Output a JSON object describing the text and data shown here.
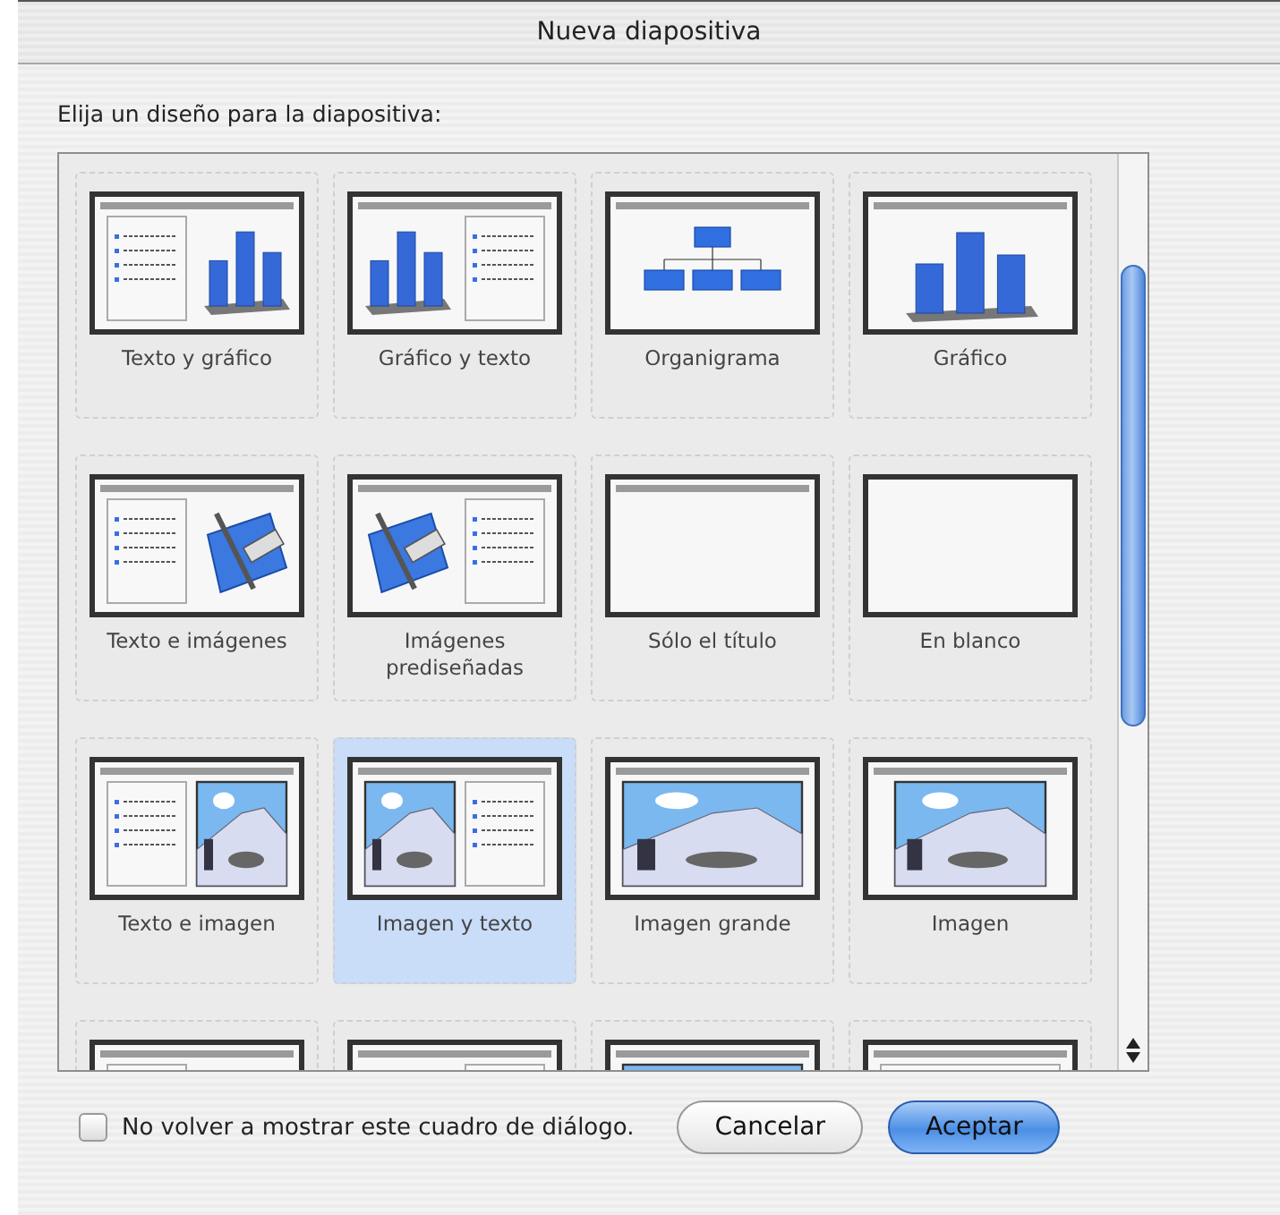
{
  "window": {
    "title": "Nueva diapositiva"
  },
  "prompt": "Elija un diseño para la diapositiva:",
  "layouts": [
    {
      "label": "Texto y gráfico",
      "kind": "text-chart",
      "selected": false
    },
    {
      "label": "Gráfico y texto",
      "kind": "chart-text",
      "selected": false
    },
    {
      "label": "Organigrama",
      "kind": "org-chart",
      "selected": false
    },
    {
      "label": "Gráfico",
      "kind": "chart",
      "selected": false
    },
    {
      "label": "Texto e imágenes",
      "kind": "text-clipart",
      "selected": false
    },
    {
      "label": "Imágenes prediseñadas",
      "kind": "clipart-text",
      "selected": false
    },
    {
      "label": "Sólo el título",
      "kind": "title-only",
      "selected": false
    },
    {
      "label": "En blanco",
      "kind": "blank",
      "selected": false
    },
    {
      "label": "Texto e imagen",
      "kind": "text-image",
      "selected": false
    },
    {
      "label": "Imagen y texto",
      "kind": "image-text",
      "selected": true
    },
    {
      "label": "Imagen grande",
      "kind": "large-image",
      "selected": false
    },
    {
      "label": "Imagen",
      "kind": "image",
      "selected": false
    },
    {
      "kind": "text-panel",
      "selected": false
    },
    {
      "kind": "panel-text",
      "selected": false
    },
    {
      "kind": "large-image",
      "selected": false
    },
    {
      "kind": "title-text",
      "selected": false
    }
  ],
  "dont_show_again": {
    "label": "No volver a mostrar este cuadro de diálogo.",
    "checked": false
  },
  "buttons": [
    {
      "label": "Cancelar",
      "default": false
    },
    {
      "label": "Aceptar",
      "default": true
    }
  ]
}
